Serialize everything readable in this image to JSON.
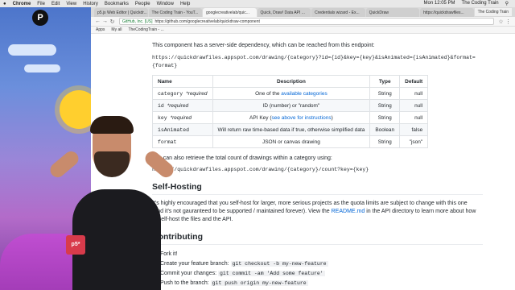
{
  "menubar": {
    "items": [
      "Chrome",
      "File",
      "Edit",
      "View",
      "History",
      "Bookmarks",
      "People",
      "Window",
      "Help"
    ],
    "clock": "Mon 12:05 PM",
    "user": "The Coding Train"
  },
  "tabs": [
    {
      "label": "p5.js Web Editor | Quickdr..."
    },
    {
      "label": "The Coding Train - YouT..."
    },
    {
      "label": "googlecreativelab/quic..."
    },
    {
      "label": "Quick, Draw! Data API ..."
    },
    {
      "label": "Credentials wizard - Ex..."
    },
    {
      "label": "QuickDraw"
    },
    {
      "label": "https://quickdrawfiles..."
    }
  ],
  "tab_user": "The Coding Train",
  "omnibox": {
    "secure_label": "GitHub, Inc. [US]",
    "url": "https://github.com/googlecreativelab/quickdraw-component"
  },
  "bookmarks": [
    "Apps",
    "My all",
    "TheCodingTrain - ..."
  ],
  "content": {
    "intro": "This component has a server-side dependency, which can be reached from this endpoint:",
    "endpoint_line1": "https://quickdrawfiles.appspot.com/drawing/{category}?id={id}&key={key}&isAnimated={isAnimated}&format=",
    "endpoint_line2": "{format}",
    "table": {
      "headers": [
        "Name",
        "Description",
        "Type",
        "Default"
      ],
      "rows": [
        {
          "name": "category",
          "req": "*required",
          "desc_pre": "One of the ",
          "desc_link": "available categories",
          "desc_post": "",
          "type": "String",
          "default": "null"
        },
        {
          "name": "id",
          "req": "*required",
          "desc_pre": "ID (number) or \"random\"",
          "desc_link": "",
          "desc_post": "",
          "type": "String",
          "default": "null"
        },
        {
          "name": "key",
          "req": "*required",
          "desc_pre": "API Key (",
          "desc_link": "see above for instructions",
          "desc_post": ")",
          "type": "String",
          "default": "null"
        },
        {
          "name": "isAnimated",
          "req": "",
          "desc_pre": "Will return raw time-based data if true, otherwise simplified data",
          "desc_link": "",
          "desc_post": "",
          "type": "Boolean",
          "default": "false"
        },
        {
          "name": "format",
          "req": "",
          "desc_pre": "JSON or canvas drawing",
          "desc_link": "",
          "desc_post": "",
          "type": "String",
          "default": "\"json\""
        }
      ]
    },
    "count_intro": "You can also retrieve the total count of drawings within a category using:",
    "count_endpoint": "https://quickdrawfiles.appspot.com/drawing/{category}/count?key={key}",
    "self_hosting_heading": "Self-Hosting",
    "self_hosting_p1": "It's highly encouraged that you self-host for larger, more serious projects as the quota limits are subject to change with this one",
    "self_hosting_p2a": "(and it's not gauranteed to be supported / maintained forever). View the ",
    "self_hosting_link": "README.md",
    "self_hosting_p2b": " in the API directory to learn more about how",
    "self_hosting_p3": "to self-host the files and the API.",
    "contributing_heading": "Contributing",
    "steps": [
      {
        "text": "Fork it!",
        "code": ""
      },
      {
        "text": "Create your feature branch: ",
        "code": "git checkout -b my-new-feature"
      },
      {
        "text": "Commit your changes: ",
        "code": "git commit -am 'Add some feature'"
      },
      {
        "text": "Push to the branch: ",
        "code": "git push origin my-new-feature"
      }
    ]
  },
  "overlay": {
    "logo_text": "P",
    "shirt_text": "p5*"
  },
  "colors": {
    "link": "#0366d6",
    "stream_bg": "#8d5ec2"
  }
}
